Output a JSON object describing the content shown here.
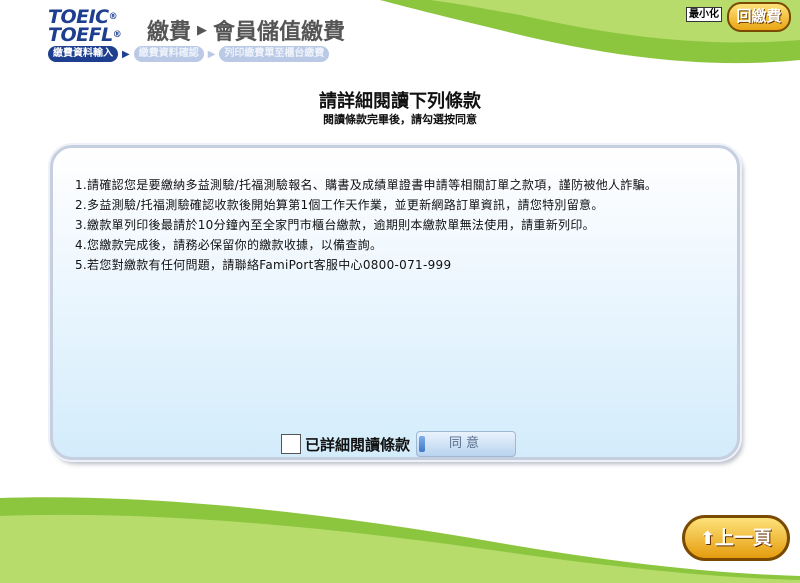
{
  "header": {
    "logo_line1": "TOEIC",
    "logo_line2": "TOEFL",
    "title_part1": "繳費",
    "title_arrow": "▶",
    "title_part2": "會員儲值繳費"
  },
  "steps": [
    {
      "label": "繳費資料輸入",
      "active": true
    },
    {
      "label": "繳費資料確認",
      "active": false
    },
    {
      "label": "列印繳費單至櫃台繳費",
      "active": false
    }
  ],
  "top_buttons": {
    "minimize_label": "最小化",
    "back_pay_label": "回繳費"
  },
  "main": {
    "title": "請詳細閱讀下列條款",
    "subtitle": "閱讀條款完畢後，請勾選按同意"
  },
  "terms": [
    "1.請確認您是要繳納多益測驗/托福測驗報名、購書及成績單證書申請等相關訂單之款項，謹防被他人詐騙。",
    "2.多益測驗/托福測驗確認收款後開始算第1個工作天作業，並更新網路訂單資訊，請您特別留意。",
    "3.繳款單列印後最請於10分鐘內至全家門市櫃台繳款，逾期則本繳款單無法使用，請重新列印。",
    "4.您繳款完成後，請務必保留你的繳款收據，以備查詢。",
    "5.若您對繳款有任何問題，請聯絡FamiPort客服中心0800-071-999"
  ],
  "agreement": {
    "checkbox_checked": false,
    "label": "已詳細閱讀條款",
    "agree_button": "同意"
  },
  "footer": {
    "prev_label": "上一頁",
    "prev_icon": "up-arrow-icon"
  },
  "colors": {
    "brand_green": "#8cc63f",
    "brand_navy": "#1e3f8f",
    "button_gold": "#f2b824"
  }
}
